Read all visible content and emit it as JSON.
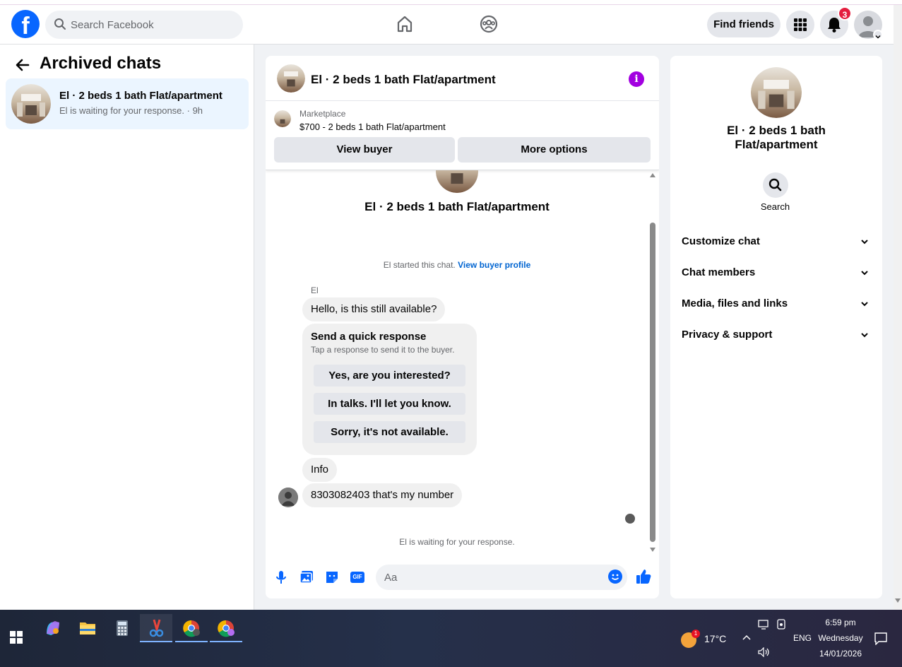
{
  "header": {
    "search_placeholder": "Search Facebook",
    "find_friends": "Find friends",
    "notification_count": "3",
    "logo_letter": "f"
  },
  "sidebar": {
    "title": "Archived chats",
    "chats": [
      {
        "name": "El · 2 beds 1 bath Flat/apartment",
        "subtitle": "El is waiting for your response. · 9h"
      }
    ]
  },
  "conversation": {
    "title": "El · 2 beds 1 bath Flat/apartment",
    "marketplace_label": "Marketplace",
    "listing": "$700 - 2 beds 1 bath Flat/apartment",
    "view_buyer": "View buyer",
    "more_options": "More options",
    "intro_name": "El · 2 beds 1 bath Flat/apartment",
    "started_text": "El started this chat.",
    "started_link": "View buyer profile",
    "sender": "El",
    "messages": [
      "Hello, is this still available?",
      "Info",
      "8303082403 that's my number"
    ],
    "quick_response": {
      "title": "Send a quick response",
      "subtitle": "Tap a response to send it to the buyer.",
      "options": [
        "Yes, are you interested?",
        "In talks. I'll let you know.",
        "Sorry, it's not available."
      ]
    },
    "waiting_text": "El is waiting for your response.",
    "composer_placeholder": "Aa",
    "gif_label": "GIF"
  },
  "info_panel": {
    "name": "El · 2 beds 1 bath Flat/apartment",
    "search_label": "Search",
    "sections": [
      "Customize chat",
      "Chat members",
      "Media, files and links",
      "Privacy & support"
    ]
  },
  "taskbar": {
    "temperature": "17°C",
    "weather_badge": "1",
    "language": "ENG",
    "time": "6:59 pm",
    "day": "Wednesday",
    "date": "14/01/2026"
  },
  "colors": {
    "brand_blue": "#0866ff",
    "info_purple": "#a200e0",
    "selected_chat_bg": "#ebf5ff",
    "badge_red": "#e41e3f"
  }
}
